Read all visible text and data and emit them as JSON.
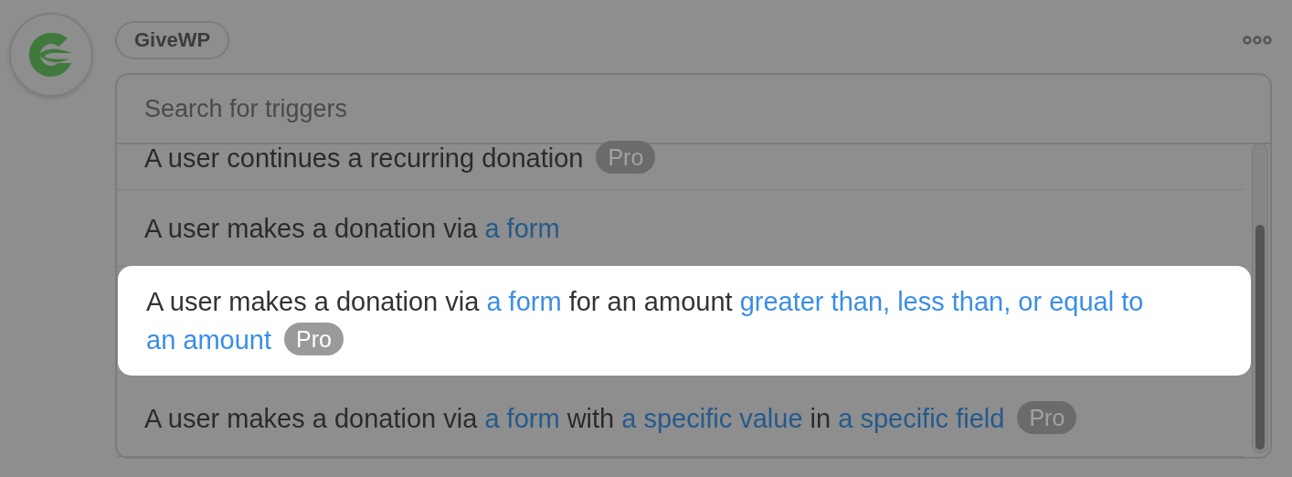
{
  "app": {
    "name": "GiveWP"
  },
  "search": {
    "placeholder": "Search for triggers"
  },
  "triggers": [
    {
      "selected": false,
      "badge": "Pro",
      "segments": [
        {
          "text": "A user continues a recurring donation",
          "link": false
        }
      ]
    },
    {
      "selected": false,
      "segments": [
        {
          "text": "A user makes a donation via ",
          "link": false
        },
        {
          "text": "a form",
          "link": true
        }
      ]
    },
    {
      "selected": true,
      "badge": "Pro",
      "segments": [
        {
          "text": "A user makes a donation via ",
          "link": false
        },
        {
          "text": "a form",
          "link": true
        },
        {
          "text": " for an amount ",
          "link": false
        },
        {
          "text": "greater than, less than, or equal to",
          "link": true
        },
        {
          "text": "an amount",
          "link": true
        }
      ]
    },
    {
      "selected": false,
      "badge": "Pro",
      "segments": [
        {
          "text": "A user makes a donation via ",
          "link": false
        },
        {
          "text": "a form",
          "link": true
        },
        {
          "text": " with ",
          "link": false
        },
        {
          "text": "a specific value",
          "link": true
        },
        {
          "text": " in ",
          "link": false
        },
        {
          "text": "a specific field",
          "link": true
        }
      ]
    }
  ]
}
